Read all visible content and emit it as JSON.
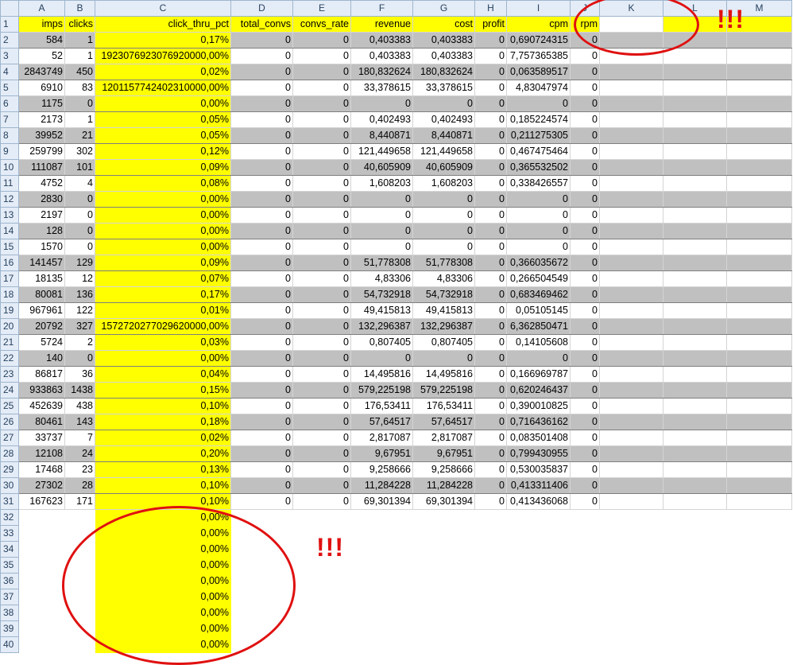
{
  "columns": [
    "A",
    "B",
    "C",
    "D",
    "E",
    "F",
    "G",
    "H",
    "I",
    "J",
    "K",
    "L",
    "M"
  ],
  "header_row": [
    "imps",
    "clicks",
    "click_thru_pct",
    "total_convs",
    "convs_rate",
    "revenue",
    "cost",
    "profit",
    "cpm",
    "rpm",
    "",
    "",
    ""
  ],
  "rows": [
    [
      "584",
      "1",
      "0,17%",
      "0",
      "0",
      "0,403383",
      "0,403383",
      "0",
      "0,690724315",
      "0"
    ],
    [
      "52",
      "1",
      "1923076923076920000,00%",
      "0",
      "0",
      "0,403383",
      "0,403383",
      "0",
      "7,757365385",
      "0"
    ],
    [
      "2843749",
      "450",
      "0,02%",
      "0",
      "0",
      "180,832624",
      "180,832624",
      "0",
      "0,063589517",
      "0"
    ],
    [
      "6910",
      "83",
      "1201157742402310000,00%",
      "0",
      "0",
      "33,378615",
      "33,378615",
      "0",
      "4,83047974",
      "0"
    ],
    [
      "1175",
      "0",
      "0,00%",
      "0",
      "0",
      "0",
      "0",
      "0",
      "0",
      "0"
    ],
    [
      "2173",
      "1",
      "0,05%",
      "0",
      "0",
      "0,402493",
      "0,402493",
      "0",
      "0,185224574",
      "0"
    ],
    [
      "39952",
      "21",
      "0,05%",
      "0",
      "0",
      "8,440871",
      "8,440871",
      "0",
      "0,211275305",
      "0"
    ],
    [
      "259799",
      "302",
      "0,12%",
      "0",
      "0",
      "121,449658",
      "121,449658",
      "0",
      "0,467475464",
      "0"
    ],
    [
      "111087",
      "101",
      "0,09%",
      "0",
      "0",
      "40,605909",
      "40,605909",
      "0",
      "0,365532502",
      "0"
    ],
    [
      "4752",
      "4",
      "0,08%",
      "0",
      "0",
      "1,608203",
      "1,608203",
      "0",
      "0,338426557",
      "0"
    ],
    [
      "2830",
      "0",
      "0,00%",
      "0",
      "0",
      "0",
      "0",
      "0",
      "0",
      "0"
    ],
    [
      "2197",
      "0",
      "0,00%",
      "0",
      "0",
      "0",
      "0",
      "0",
      "0",
      "0"
    ],
    [
      "128",
      "0",
      "0,00%",
      "0",
      "0",
      "0",
      "0",
      "0",
      "0",
      "0"
    ],
    [
      "1570",
      "0",
      "0,00%",
      "0",
      "0",
      "0",
      "0",
      "0",
      "0",
      "0"
    ],
    [
      "141457",
      "129",
      "0,09%",
      "0",
      "0",
      "51,778308",
      "51,778308",
      "0",
      "0,366035672",
      "0"
    ],
    [
      "18135",
      "12",
      "0,07%",
      "0",
      "0",
      "4,83306",
      "4,83306",
      "0",
      "0,266504549",
      "0"
    ],
    [
      "80081",
      "136",
      "0,17%",
      "0",
      "0",
      "54,732918",
      "54,732918",
      "0",
      "0,683469462",
      "0"
    ],
    [
      "967961",
      "122",
      "0,01%",
      "0",
      "0",
      "49,415813",
      "49,415813",
      "0",
      "0,05105145",
      "0"
    ],
    [
      "20792",
      "327",
      "1572720277029620000,00%",
      "0",
      "0",
      "132,296387",
      "132,296387",
      "0",
      "6,362850471",
      "0"
    ],
    [
      "5724",
      "2",
      "0,03%",
      "0",
      "0",
      "0,807405",
      "0,807405",
      "0",
      "0,14105608",
      "0"
    ],
    [
      "140",
      "0",
      "0,00%",
      "0",
      "0",
      "0",
      "0",
      "0",
      "0",
      "0"
    ],
    [
      "86817",
      "36",
      "0,04%",
      "0",
      "0",
      "14,495816",
      "14,495816",
      "0",
      "0,166969787",
      "0"
    ],
    [
      "933863",
      "1438",
      "0,15%",
      "0",
      "0",
      "579,225198",
      "579,225198",
      "0",
      "0,620246437",
      "0"
    ],
    [
      "452639",
      "438",
      "0,10%",
      "0",
      "0",
      "176,53411",
      "176,53411",
      "0",
      "0,390010825",
      "0"
    ],
    [
      "80461",
      "143",
      "0,18%",
      "0",
      "0",
      "57,64517",
      "57,64517",
      "0",
      "0,716436162",
      "0"
    ],
    [
      "33737",
      "7",
      "0,02%",
      "0",
      "0",
      "2,817087",
      "2,817087",
      "0",
      "0,083501408",
      "0"
    ],
    [
      "12108",
      "24",
      "0,20%",
      "0",
      "0",
      "9,67951",
      "9,67951",
      "0",
      "0,799430955",
      "0"
    ],
    [
      "17468",
      "23",
      "0,13%",
      "0",
      "0",
      "9,258666",
      "9,258666",
      "0",
      "0,530035837",
      "0"
    ],
    [
      "27302",
      "28",
      "0,10%",
      "0",
      "0",
      "11,284228",
      "11,284228",
      "0",
      "0,413311406",
      "0"
    ],
    [
      "167623",
      "171",
      "0,10%",
      "0",
      "0",
      "69,301394",
      "69,301394",
      "0",
      "0,413436068",
      "0"
    ]
  ],
  "extra_rows_c": [
    "0,00%",
    "0,00%",
    "0,00%",
    "0,00%",
    "0,00%",
    "0,00%",
    "0,00%",
    "0,00%",
    "0,00%"
  ],
  "annotations": {
    "exclaim_top": "!!!",
    "exclaim_mid": "!!!"
  },
  "colors": {
    "highlight": "#ffff00",
    "band": "#c0c0c0",
    "annotation": "#e01010"
  }
}
